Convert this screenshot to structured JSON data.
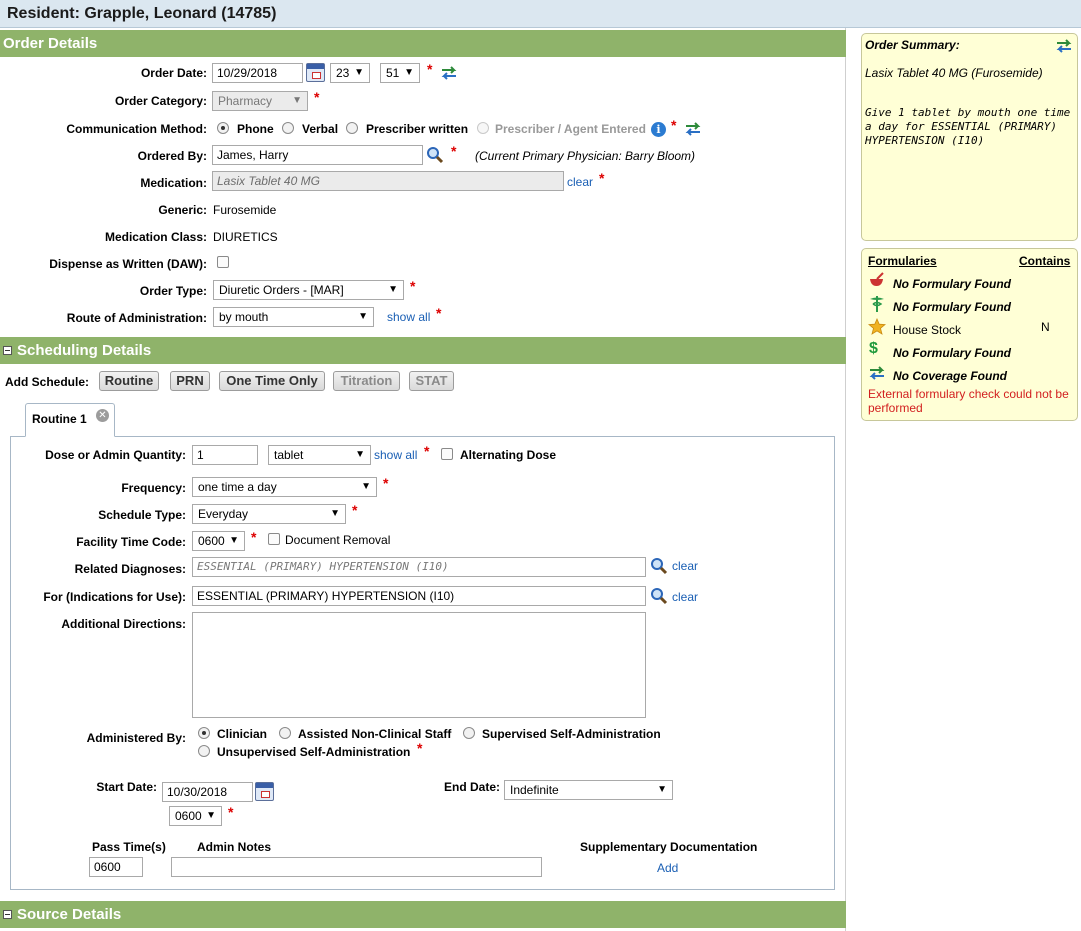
{
  "header": {
    "title": "Resident: Grapple, Leonard (14785)"
  },
  "sections": {
    "order_details": "Order Details",
    "scheduling_details": "Scheduling Details",
    "source_details": "Source Details"
  },
  "order": {
    "order_date_label": "Order Date:",
    "order_date": "10/29/2018",
    "order_hour": "23",
    "order_minute": "51",
    "category_label": "Order Category:",
    "category": "Pharmacy",
    "comm_label": "Communication Method:",
    "comm_phone": "Phone",
    "comm_verbal": "Verbal",
    "comm_prescriber": "Prescriber written",
    "comm_agent": "Prescriber / Agent Entered",
    "ordered_by_label": "Ordered By:",
    "ordered_by": "James, Harry",
    "primary_physician": "(Current Primary Physician:  Barry Bloom)",
    "medication_label": "Medication:",
    "medication": "Lasix Tablet 40 MG",
    "clear": "clear",
    "generic_label": "Generic:",
    "generic": "Furosemide",
    "med_class_label": "Medication Class:",
    "med_class": "DIURETICS",
    "daw_label": "Dispense as Written (DAW):",
    "order_type_label": "Order Type:",
    "order_type": "Diuretic Orders - [MAR]",
    "route_label": "Route of Administration:",
    "route": "by mouth",
    "show_all": "show all"
  },
  "scheduling": {
    "add_schedule_label": "Add Schedule:",
    "buttons": {
      "routine": "Routine",
      "prn": "PRN",
      "one_time": "One Time Only",
      "titration": "Titration",
      "stat": "STAT"
    },
    "tab_label": "Routine 1",
    "dose_label": "Dose or Admin Quantity:",
    "dose": "1",
    "unit": "tablet",
    "show_all": "show all",
    "alternating_label": "Alternating Dose",
    "frequency_label": "Frequency:",
    "frequency": "one time a day",
    "schedule_type_label": "Schedule Type:",
    "schedule_type": "Everyday",
    "facility_time_label": "Facility Time Code:",
    "facility_time": "0600",
    "doc_removal_label": "Document Removal",
    "related_dx_label": "Related Diagnoses:",
    "related_dx": "ESSENTIAL (PRIMARY) HYPERTENSION (I10)",
    "indications_label": "For (Indications for Use):",
    "indications": "ESSENTIAL (PRIMARY) HYPERTENSION (I10)",
    "clear": "clear",
    "additional_label": "Additional Directions:",
    "administered_label": "Administered By:",
    "admin_clinician": "Clinician",
    "admin_assisted": "Assisted Non-Clinical Staff",
    "admin_supervised": "Supervised Self-Administration",
    "admin_unsupervised": "Unsupervised Self-Administration",
    "start_date_label": "Start Date:",
    "start_date": "10/30/2018",
    "start_time": "0600",
    "end_date_label": "End Date:",
    "end_date": "Indefinite",
    "pass_times_label": "Pass Time(s)",
    "pass_time": "0600",
    "admin_notes_label": "Admin Notes",
    "supp_doc_label": "Supplementary Documentation",
    "add_link": "Add"
  },
  "summary": {
    "title": "Order Summary:",
    "medication": "Lasix Tablet 40 MG (Furosemide)",
    "directions": "Give 1 tablet by mouth one time a day for ESSENTIAL (PRIMARY) HYPERTENSION (I10)"
  },
  "formularies": {
    "header_left": "Formularies",
    "header_right": "Contains",
    "rows": [
      {
        "icon": "mortar-pestle-icon",
        "text": "No Formulary Found"
      },
      {
        "icon": "caduceus-icon",
        "text": "No Formulary Found"
      },
      {
        "icon": "star-icon",
        "text": "House Stock",
        "contains": "N"
      },
      {
        "icon": "dollar-icon",
        "text": "No Formulary Found"
      },
      {
        "icon": "swap-arrows-icon",
        "text": "No Coverage Found"
      }
    ],
    "error": "External formulary check could not be performed"
  },
  "req_mark": "*",
  "colors": {
    "section_bar": "#8fb36a",
    "panel_bg": "#ffffd6",
    "link": "#1a5fb4",
    "required": "#dd0000"
  }
}
